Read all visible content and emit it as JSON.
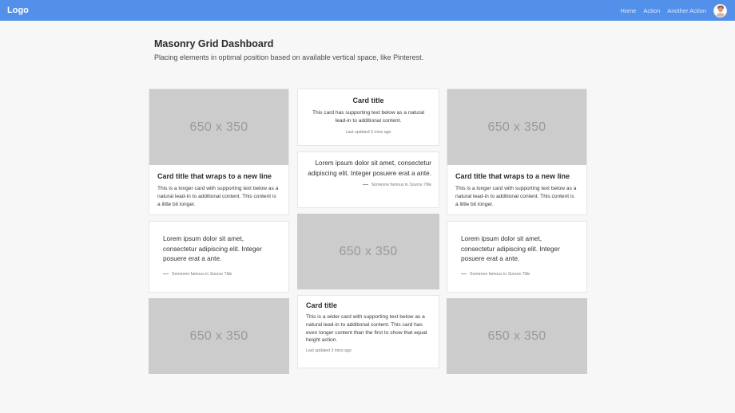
{
  "navbar": {
    "logo": "Logo",
    "links": [
      "Home",
      "Action",
      "Another Action"
    ]
  },
  "header": {
    "title": "Masonry Grid Dashboard",
    "lead": "Placing elements in optimal position based on available vertical space, like Pinterest."
  },
  "placeholder": "650 x 350",
  "cards": {
    "wrap": {
      "title": "Card title that wraps to a new line",
      "text": "This is a longer card with supporting text below as a natural lead-in to additional content. This content is a little bit longer."
    },
    "center_top": {
      "title": "Card title",
      "text": "This card has supporting text below as a natural lead-in to additional content.",
      "updated": "Last updated 3 mins ago"
    },
    "quote": {
      "text": "Lorem ipsum dolor sit amet, consectetur adipiscing elit. Integer posuere erat a ante.",
      "footer_prefix": "Someone famous in ",
      "footer_source": "Source Title"
    },
    "wider": {
      "title": "Card title",
      "text": "This is a wider card with supporting text below as a natural lead-in to additional content. This card has even longer content than the first to show that equal height action.",
      "updated": "Last updated 3 mins ago"
    }
  }
}
